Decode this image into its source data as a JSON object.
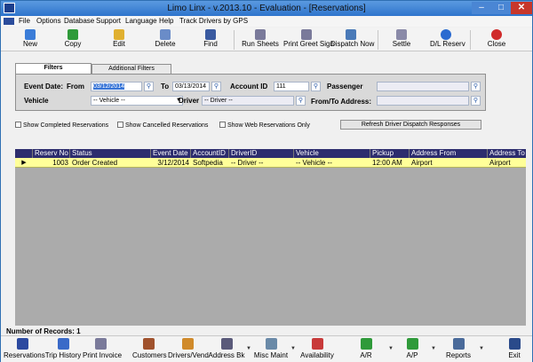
{
  "window": {
    "title": "Limo Linx - v.2013.10 - Evaluation - [Reservations]"
  },
  "menu": [
    "File",
    "Options",
    "Database",
    "Support",
    "Language",
    "Help",
    "Track Drivers by GPS"
  ],
  "toolbar": {
    "new": "New",
    "copy": "Copy",
    "edit": "Edit",
    "delete": "Delete",
    "find": "Find",
    "run_sheets": "Run Sheets",
    "print_greet": "Print Greet Sign",
    "dispatch_now": "Dispatch Now",
    "settle": "Settle",
    "dl_reserv": "D/L Reserv",
    "close": "Close"
  },
  "tabs": {
    "filters": "Filters",
    "additional": "Additional Filters"
  },
  "filters": {
    "event_date_label": "Event Date:",
    "from_label": "From",
    "from_value": "03/12/2014",
    "to_label": "To",
    "to_value": "03/13/2014",
    "account_id_label": "Account ID",
    "account_id_value": "111",
    "passenger_label": "Passenger",
    "passenger_value": "",
    "vehicle_label": "Vehicle",
    "vehicle_value": "-- Vehicle --",
    "driver_label": "Driver",
    "driver_value": "-- Driver --",
    "from_to_label": "From/To Address:",
    "from_to_value": ""
  },
  "options": {
    "show_completed": "Show Completed Reservations",
    "show_cancelled": "Show Cancelled Reservations",
    "show_web": "Show Web Reservations Only",
    "refresh": "Refresh Driver Dispatch Responses"
  },
  "grid": {
    "columns": [
      "Reserv No",
      "Status",
      "Event Date",
      "AccountID",
      "DriverID",
      "Vehicle",
      "Pickup",
      "Address From",
      "Address To"
    ],
    "rows": [
      [
        "1003",
        "Order Created",
        "3/12/2014",
        "Softpedia",
        "-- Driver --",
        "-- Vehicle --",
        "12:00 AM",
        "Airport",
        "Airport"
      ]
    ]
  },
  "status": {
    "records": "Number of Records: 1"
  },
  "bottom": {
    "reservations": "Reservations",
    "trip_history": "Trip History",
    "print_invoice": "Print Invoice",
    "customers": "Customers",
    "drivers": "Drivers/Vend",
    "address_bk": "Address Bk",
    "misc_maint": "Misc Maint",
    "availability": "Availability",
    "ar": "A/R",
    "ap": "A/P",
    "reports": "Reports",
    "exit": "Exit"
  }
}
